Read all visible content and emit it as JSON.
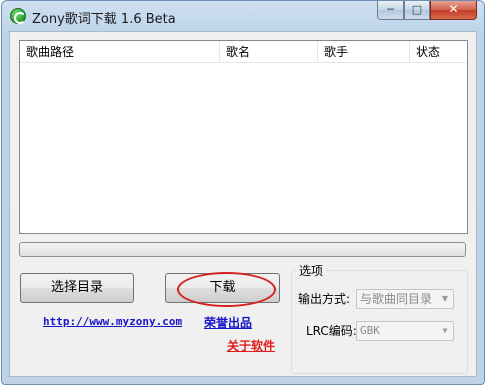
{
  "window": {
    "title": "Zony歌词下载 1.6 Beta",
    "controls": {
      "minimize": "─",
      "maximize": "□",
      "close": "✕"
    }
  },
  "listview": {
    "columns": [
      "歌曲路径",
      "歌名",
      "歌手",
      "状态"
    ],
    "rows": []
  },
  "progress": {
    "value": 0
  },
  "buttons": {
    "select_dir": "选择目录",
    "download": "下载"
  },
  "links": {
    "site": "http://www.myzony.com",
    "credit": "荣誉出品",
    "about": "关于软件"
  },
  "options": {
    "group_title": "选项",
    "output_label": "输出方式:",
    "output_value": "与歌曲同目录",
    "encoding_label": "LRC编码:",
    "encoding_value": "GBK"
  },
  "colors": {
    "link_blue": "#1515c8",
    "about_red": "#e01b1b",
    "annotation_ellipse": "#d42020"
  }
}
